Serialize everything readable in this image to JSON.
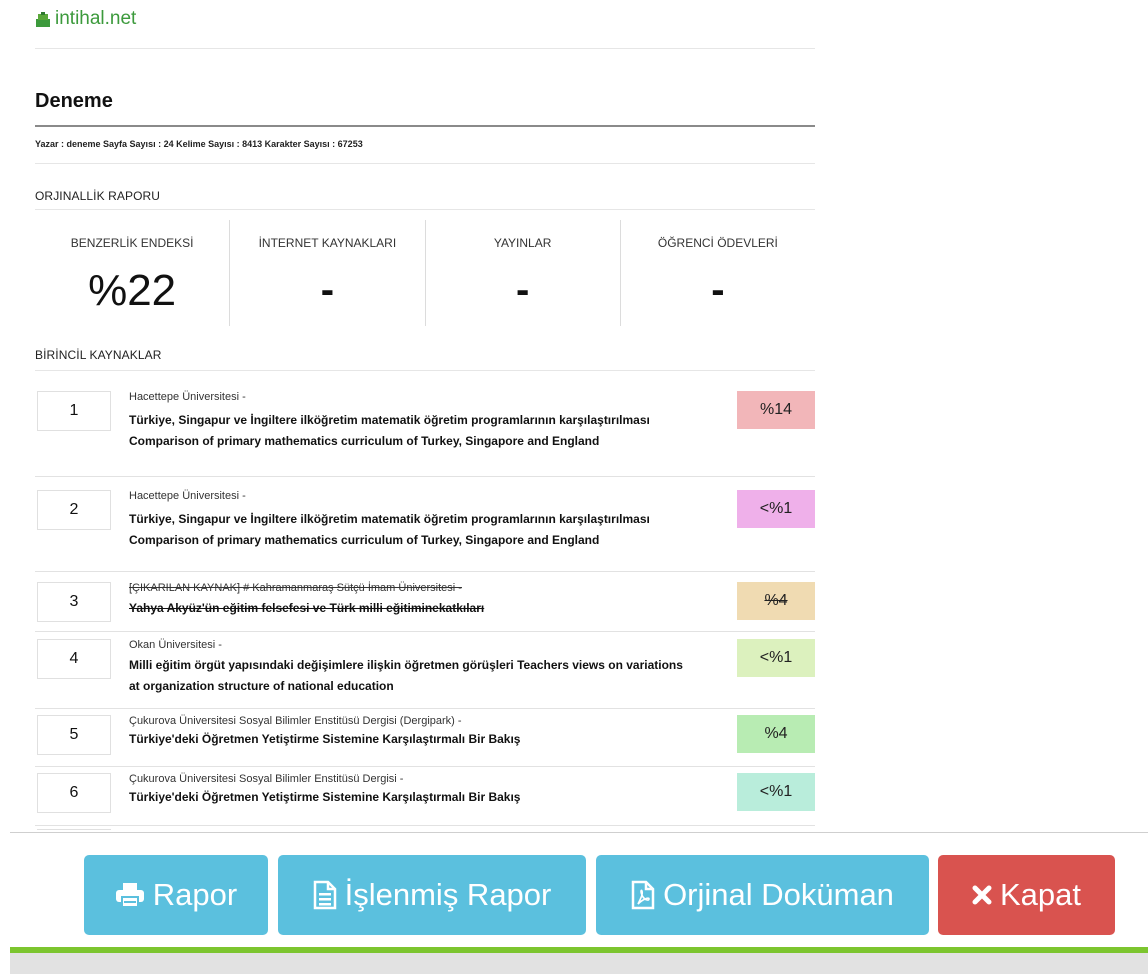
{
  "site": {
    "logo_text": "intihal.net"
  },
  "document": {
    "title": "Deneme",
    "meta_line": "Yazar : deneme Sayfa Sayısı : 24 Kelime Sayısı : 8413 Karakter Sayısı : 67253"
  },
  "report": {
    "heading": "ORJINALLİK RAPORU",
    "stats": [
      {
        "label": "BENZERLİK ENDEKSİ",
        "value": "%22"
      },
      {
        "label": "İNTERNET KAYNAKLARI",
        "value": "-"
      },
      {
        "label": "YAYINLAR",
        "value": "-"
      },
      {
        "label": "ÖĞRENCİ ÖDEVLERİ",
        "value": "-"
      }
    ]
  },
  "sources": {
    "heading": "BİRİNCİL KAYNAKLAR",
    "items": [
      {
        "num": "1",
        "source": "Hacettepe Üniversitesi -",
        "title": "Türkiye, Singapur ve İngiltere ilköğretim matematik öğretim programlarının karşılaştırılması Comparison of primary mathematics curriculum of Turkey, Singapore and England",
        "percent": "%14",
        "color": "#f2b6b9",
        "struck": false
      },
      {
        "num": "2",
        "source": "Hacettepe Üniversitesi -",
        "title": "Türkiye, Singapur ve İngiltere ilköğretim matematik öğretim programlarının karşılaştırılması Comparison of primary mathematics curriculum of Turkey, Singapore and England",
        "percent": "<%1",
        "color": "#efb0ea",
        "struck": false
      },
      {
        "num": "3",
        "source": "[ÇIKARILAN KAYNAK] # Kahramanmaraş Sütçü İmam Üniversitesi -",
        "title": "Yahya Akyüz'ün eğitim felsefesi ve Türk milli eğitiminekatkıları",
        "percent": "%4",
        "color": "#f0dbb2",
        "struck": true
      },
      {
        "num": "4",
        "source": "Okan Üniversitesi -",
        "title": "Milli eğitim örgüt yapısındaki değişimlere ilişkin öğretmen görüşleri Teachers views on variations at organization structure of national education",
        "percent": "<%1",
        "color": "#dcf1be",
        "struck": false
      },
      {
        "num": "5",
        "source": "Çukurova Üniversitesi Sosyal Bilimler Enstitüsü Dergisi (Dergipark) -",
        "title": "Türkiye'deki Öğretmen Yetiştirme Sistemine Karşılaştırmalı Bir Bakış",
        "percent": "%4",
        "color": "#b8ecb3",
        "struck": false
      },
      {
        "num": "6",
        "source": "Çukurova Üniversitesi Sosyal Bilimler Enstitüsü Dergisi -",
        "title": "Türkiye'deki Öğretmen Yetiştirme Sistemine Karşılaştırmalı Bir Bakış",
        "percent": "<%1",
        "color": "#b9eddb",
        "struck": false
      }
    ]
  },
  "buttons": {
    "rapor": "Rapor",
    "islenmis_rapor": "İşlenmiş Rapor",
    "orjinal_dokuman": "Orjinal Doküman",
    "kapat": "Kapat"
  },
  "colors": {
    "info": "#5bc0de",
    "danger": "#d9534f",
    "brand_green": "#7cc52f"
  }
}
